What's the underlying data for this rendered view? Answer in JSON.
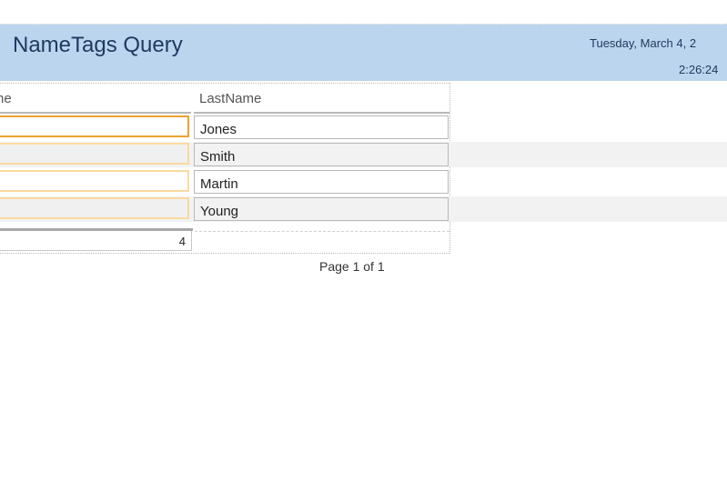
{
  "report": {
    "title": "NameTags Query",
    "date": "Tuesday, March 4, 2",
    "time": "2:26:24"
  },
  "columns": {
    "first_name_header": "ne",
    "last_name_header": "LastName"
  },
  "rows": [
    {
      "first_name": "",
      "last_name": "Jones"
    },
    {
      "first_name": "",
      "last_name": "Smith"
    },
    {
      "first_name": "",
      "last_name": "Martin"
    },
    {
      "first_name": "",
      "last_name": "Young"
    }
  ],
  "footer": {
    "record_count": "4",
    "page_label": "Page 1 of 1"
  },
  "colors": {
    "header_band": "#bcd5ee",
    "title_text": "#1f3a60",
    "selected_cell_border": "#f0a030",
    "cell_border": "#fbd9a0",
    "alternate_row": "#f2f2f2"
  }
}
